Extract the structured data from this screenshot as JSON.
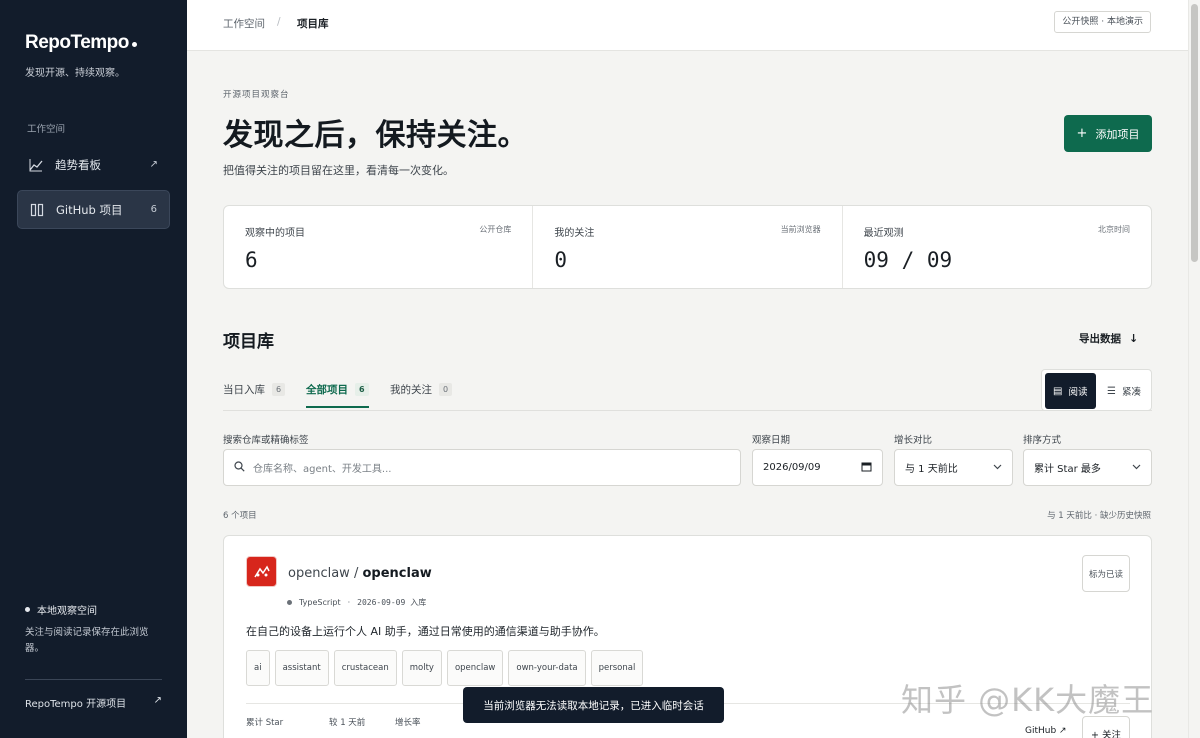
{
  "app": {
    "name": "RepoTempo",
    "tagline": "发现开源、持续观察。"
  },
  "sidebar": {
    "section_label": "工作空间",
    "items": [
      {
        "label": "趋势看板",
        "icon": "trend-chart-icon",
        "trail": "↗"
      },
      {
        "label": "GitHub 项目",
        "icon": "columns-icon",
        "trail": "6"
      }
    ],
    "local_space_title": "本地观察空间",
    "local_space_desc": "关注与阅读记录保存在此浏览器。",
    "footer_link": "RepoTempo 开源项目",
    "footer_icon": "↗"
  },
  "topbar": {
    "breadcrumb": [
      "工作空间",
      "/",
      "项目库"
    ],
    "badge": "公开快照 · 本地演示"
  },
  "hero": {
    "eyebrow": "开源项目观察台",
    "title": "发现之后，保持关注。",
    "subtitle": "把值得关注的项目留在这里，看清每一次变化。",
    "add_button": "添加项目",
    "add_icon": "+"
  },
  "stats": [
    {
      "label": "观察中的项目",
      "hint": "公开仓库",
      "value": "6"
    },
    {
      "label": "我的关注",
      "hint": "当前浏览器",
      "value": "0"
    },
    {
      "label": "最近观测",
      "hint": "北京时间",
      "value": "09 / 09"
    }
  ],
  "library": {
    "title": "项目库",
    "export_label": "导出数据",
    "export_icon": "↓",
    "tabs": [
      {
        "label": "当日入库",
        "count": "6"
      },
      {
        "label": "全部项目",
        "count": "6"
      },
      {
        "label": "我的关注",
        "count": "0"
      }
    ],
    "view": {
      "read": "阅读",
      "compact": "紧凑",
      "read_icon": "▤",
      "compact_icon": "☰"
    }
  },
  "filters": {
    "search_label": "搜索仓库或精确标签",
    "search_placeholder": "仓库名称、agent、开发工具...",
    "date_label": "观察日期",
    "date_value": "2026/09/09",
    "compare_label": "增长对比",
    "compare_value": "与 1 天前比",
    "sort_label": "排序方式",
    "sort_value": "累计 Star 最多"
  },
  "results": {
    "count_text": "6 个项目",
    "note": "与 1 天前比 · 缺少历史快照"
  },
  "repo": {
    "owner": "openclaw",
    "sep": " / ",
    "name": "openclaw",
    "language": "TypeScript",
    "dot": "·",
    "date": "2026-09-09",
    "added": "入库",
    "mark_read": "标为已读",
    "description": "在自己的设备上运行个人 AI 助手，通过日常使用的通信渠道与助手协作。",
    "tags": [
      "ai",
      "assistant",
      "crustacean",
      "molty",
      "openclaw",
      "own-your-data",
      "personal"
    ],
    "stat_labels": [
      "累计 Star",
      "较 1 天前",
      "增长率"
    ],
    "github_link": "GitHub ↗",
    "follow": "+ 关注"
  },
  "toast": "当前浏览器无法读取本地记录，已进入临时会话",
  "watermark": "知乎 @KK大魔王"
}
